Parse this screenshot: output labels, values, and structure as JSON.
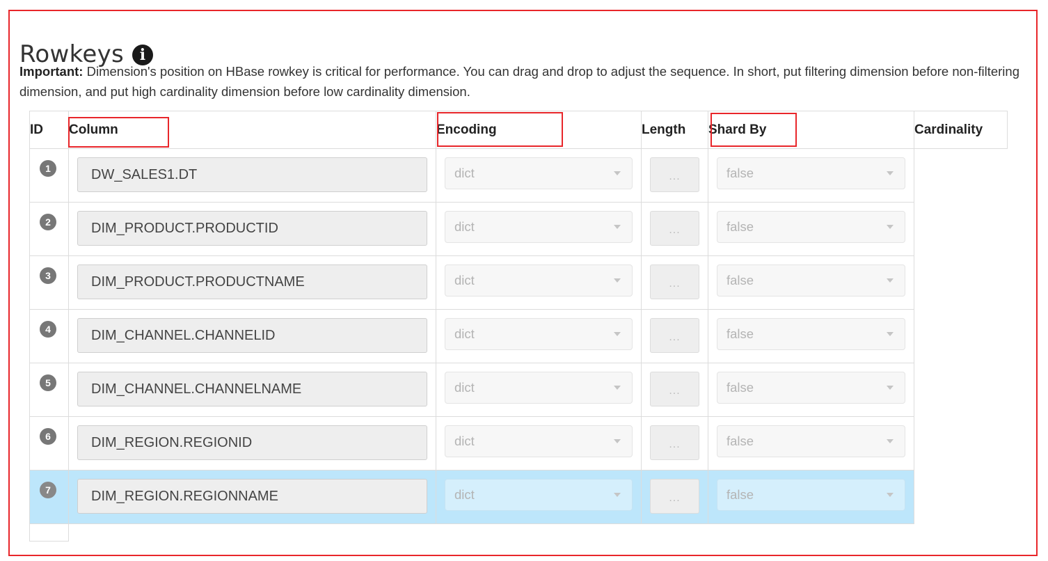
{
  "page": {
    "title": "Rowkeys",
    "info_icon": "info-circle-icon",
    "note_bold": "Important:",
    "note_text": " Dimension's position on HBase rowkey is critical for performance. You can drag and drop to adjust the sequence. In short, put filtering dimension before non-filtering dimension, and put high cardinality dimension before low cardinality dimension."
  },
  "table": {
    "headers": {
      "id": "ID",
      "column": "Column",
      "encoding": "Encoding",
      "length": "Length",
      "shard_by": "Shard By",
      "cardinality": "Cardinality"
    },
    "rows": [
      {
        "id": "1",
        "column": "DW_SALES1.DT",
        "encoding": "dict",
        "length": "...",
        "shard_by": "false"
      },
      {
        "id": "2",
        "column": "DIM_PRODUCT.PRODUCTID",
        "encoding": "dict",
        "length": "...",
        "shard_by": "false"
      },
      {
        "id": "3",
        "column": "DIM_PRODUCT.PRODUCTNAME",
        "encoding": "dict",
        "length": "...",
        "shard_by": "false"
      },
      {
        "id": "4",
        "column": "DIM_CHANNEL.CHANNELID",
        "encoding": "dict",
        "length": "...",
        "shard_by": "false"
      },
      {
        "id": "5",
        "column": "DIM_CHANNEL.CHANNELNAME",
        "encoding": "dict",
        "length": "...",
        "shard_by": "false"
      },
      {
        "id": "6",
        "column": "DIM_REGION.REGIONID",
        "encoding": "dict",
        "length": "...",
        "shard_by": "false"
      },
      {
        "id": "7",
        "column": "DIM_REGION.REGIONNAME",
        "encoding": "dict",
        "length": "...",
        "shard_by": "false"
      }
    ],
    "selected_row": "7"
  },
  "colors": {
    "highlight": "#e8262a",
    "selected_row": "#bde6fb",
    "badge": "#777777"
  }
}
